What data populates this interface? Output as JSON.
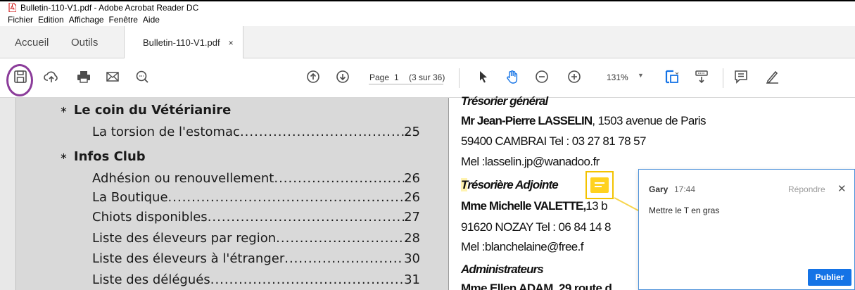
{
  "window": {
    "title": "Bulletin-110-V1.pdf - Adobe Acrobat Reader DC"
  },
  "menubar": {
    "items": [
      "Fichier",
      "Edition",
      "Affichage",
      "Fenêtre",
      "Aide"
    ]
  },
  "tabs": {
    "home": "Accueil",
    "tools": "Outils",
    "document": "Bulletin-110-V1.pdf",
    "close": "×"
  },
  "toolbar": {
    "icons": [
      "save-icon",
      "upload-icon",
      "print-icon",
      "email-icon",
      "search-icon",
      "page-up-icon",
      "page-down-icon",
      "select-icon",
      "hand-icon",
      "zoom-out-icon",
      "zoom-in-icon",
      "fit-icon",
      "scroll-mode-icon",
      "comment-icon",
      "highlight-pen-icon"
    ],
    "page_label": "Page",
    "page_number": "1",
    "page_count": "(3 sur 36)",
    "zoom": "131%",
    "accent_color": "#1473e6",
    "highlight_color": "#8b3c9a"
  },
  "toc": {
    "sections": [
      {
        "bullet": "∗",
        "heading": "Le coin du Vétérianire",
        "entries": [
          {
            "title": "La torsion de l'estomac ",
            "page": "25"
          }
        ]
      },
      {
        "bullet": "∗",
        "heading": "Infos Club",
        "entries": [
          {
            "title": "Adhésion ou renouvellement ",
            "page": "26"
          },
          {
            "title": "La Boutique ",
            "page": "26"
          },
          {
            "title": "Chiots disponibles ",
            "page": "27"
          },
          {
            "title": "Liste des éleveurs par region ",
            "page": "28"
          },
          {
            "title": "Liste des éleveurs à l'étranger ",
            "page": "30"
          },
          {
            "title": "Liste des délégués ",
            "page": "31"
          }
        ]
      }
    ]
  },
  "document": {
    "line1": "Trésorier général",
    "line2_bold": "Mr Jean-Pierre LASSELIN",
    "line2_rest": ", 1503 avenue de Paris",
    "line3": "59400 CAMBRAI  Tel : 03 27 81 78 57",
    "line4": "Mel :lasselin.jp@wanadoo.fr",
    "line5_T": "T",
    "line5_rest": "résorière Adjointe",
    "line6_bold": "Mme Michelle VALETTE,",
    "line6_rest": "13 b",
    "line7": "91620 NOZAY Tel : 06 84 14 8",
    "line8": "Mel :blanchelaine@free.f",
    "line9": "Administrateurs",
    "line10": "Mme Ellen ADAM, 29 route d"
  },
  "comment": {
    "author": "Gary",
    "time": "17:44",
    "reply": "Répondre",
    "close": "✕",
    "text": "Mettre le T en gras",
    "publish": "Publier",
    "note_color": "#ffd21f"
  }
}
